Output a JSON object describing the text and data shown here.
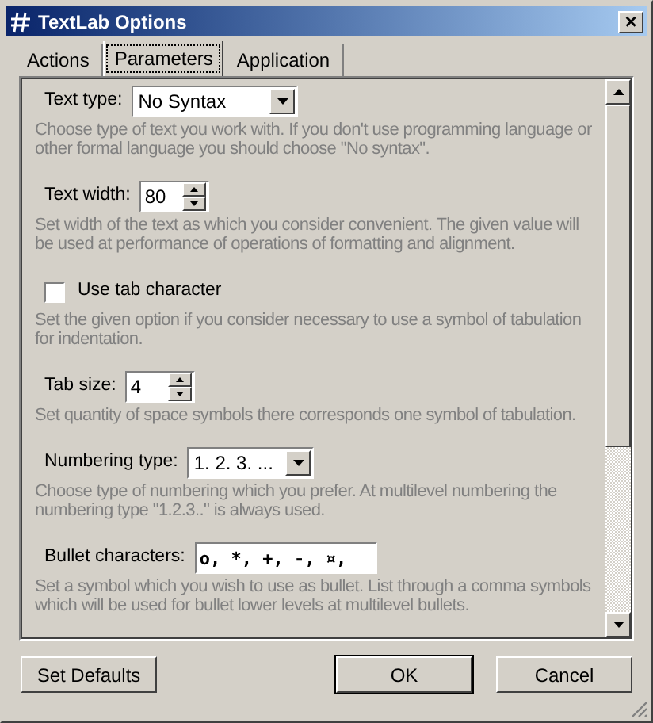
{
  "window": {
    "title": "TextLab Options",
    "close": "×"
  },
  "tabs": [
    {
      "label": "Actions",
      "selected": false
    },
    {
      "label": "Parameters",
      "selected": true
    },
    {
      "label": "Application",
      "selected": false
    }
  ],
  "options": [
    {
      "kind": "dropdown",
      "label": "Text type:",
      "value": "No Syntax",
      "description": "Choose type of text you work with. If you don't use programming language or other formal language you should choose \"No syntax\"."
    },
    {
      "kind": "spin",
      "label": "Text width:",
      "value": "80",
      "description": "Set width of the text as which you consider convenient. The given value will be used at performance of operations of formatting and alignment."
    },
    {
      "kind": "checkbox",
      "label": "Use tab character",
      "checked": false,
      "description": "Set the given option if you consider necessary to use a symbol of tabulation for indentation."
    },
    {
      "kind": "spin",
      "label": "Tab size:",
      "value": "4",
      "description": "Set quantity of space symbols there corresponds one symbol of tabulation."
    },
    {
      "kind": "dropdown",
      "label": "Numbering type:",
      "value": "1. 2. 3. ...",
      "description": "Choose type of numbering which you prefer. At multilevel numbering the numbering type \"1.2.3..\" is always used."
    },
    {
      "kind": "text",
      "label": "Bullet characters:",
      "value": "o, *, +, -, ¤,",
      "description": "Set a symbol which you wish to use as bullet. List through a comma symbols which will be used for bullet lower levels at multilevel bullets."
    }
  ],
  "buttons": [
    {
      "label": "Set Defaults",
      "kind": "defaults"
    },
    {
      "label": "OK",
      "kind": "ok"
    },
    {
      "label": "Cancel",
      "kind": "cancel"
    }
  ]
}
